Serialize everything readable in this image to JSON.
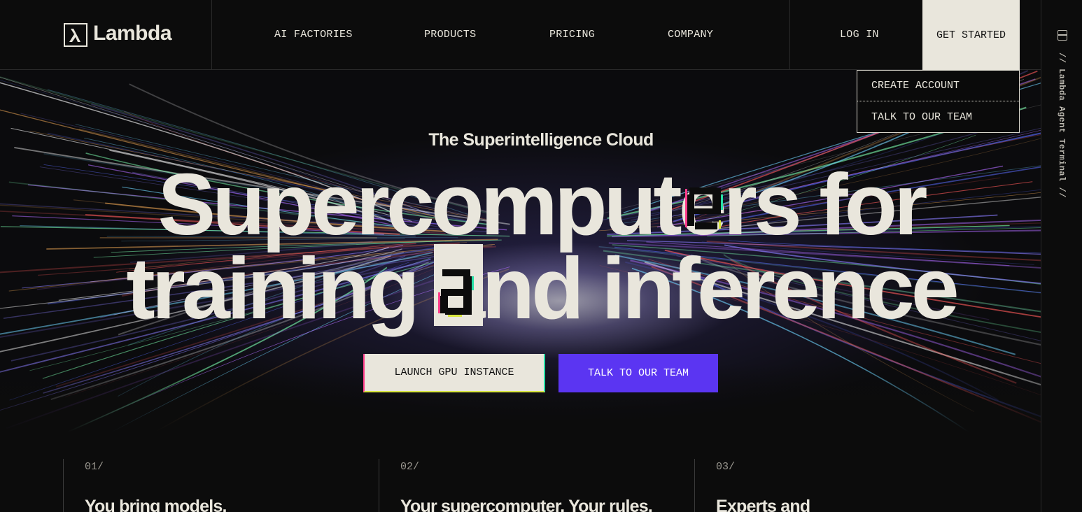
{
  "brand": {
    "name": "Lambda",
    "logo_glyph": "λ"
  },
  "nav": {
    "items": [
      {
        "label": "AI FACTORIES"
      },
      {
        "label": "PRODUCTS"
      },
      {
        "label": "PRICING"
      },
      {
        "label": "COMPANY"
      }
    ],
    "login_label": "LOG IN",
    "get_started_label": "GET STARTED"
  },
  "dropdown": {
    "items": [
      {
        "label": "CREATE ACCOUNT"
      },
      {
        "label": "TALK TO OUR TEAM"
      }
    ]
  },
  "rail": {
    "label": "// Lambda Agent Terminal //",
    "icon": "panel-icon"
  },
  "hero": {
    "eyebrow": "The Superintelligence Cloud",
    "headline_line1": "Supercomputers for",
    "headline_line2": "training and inference",
    "cta_primary": "LAUNCH GPU INSTANCE",
    "cta_secondary": "TALK TO OUR TEAM"
  },
  "features": [
    {
      "num": "01/",
      "title": "You bring models."
    },
    {
      "num": "02/",
      "title": "Your supercomputer. Your rules."
    },
    {
      "num": "03/",
      "title": "Experts and"
    }
  ],
  "colors": {
    "background": "#0c0c0c",
    "text": "#e9e6dc",
    "accent_purple": "#5b35f2",
    "cream": "#e9e6dc"
  }
}
